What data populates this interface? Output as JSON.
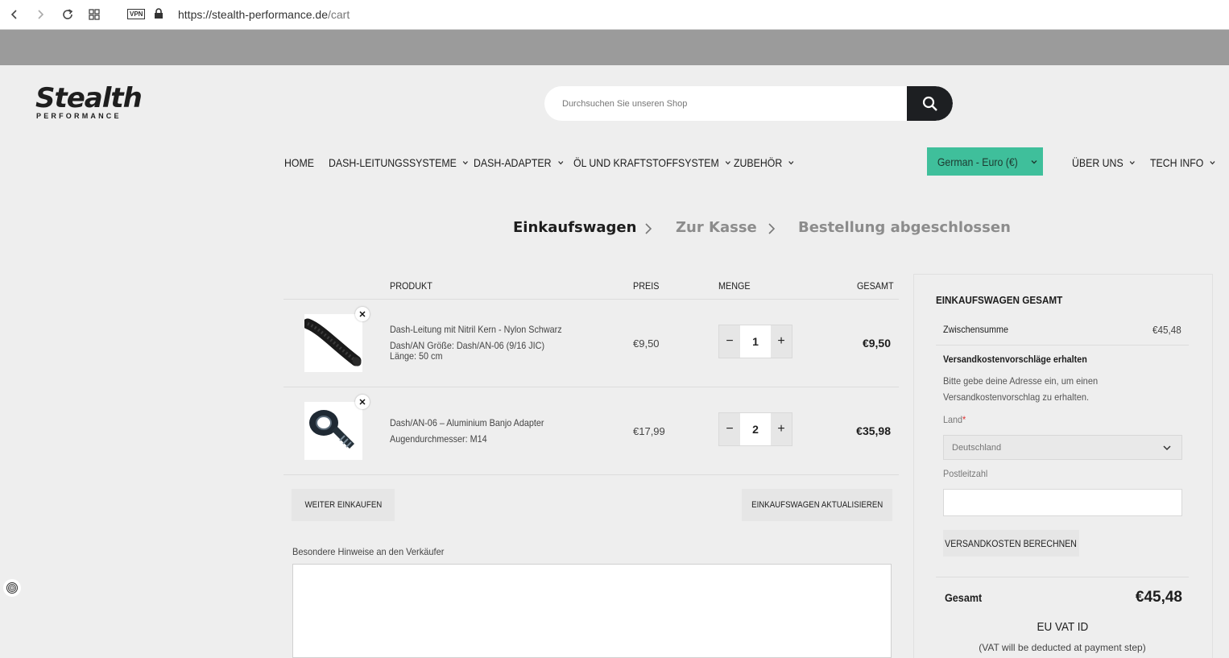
{
  "browser": {
    "vpn_label": "VPN",
    "url_host": "https://stealth-performance.de",
    "url_path": "/cart"
  },
  "header": {
    "logo_main": "Stealth",
    "logo_sub": "PERFORMANCE",
    "search_placeholder": "Durchsuchen Sie unseren Shop"
  },
  "nav": {
    "home": "HOME",
    "dash_leitung": "DASH-LEITUNGSSYSTEME",
    "dash_adapter": "DASH-ADAPTER",
    "oel": "ÖL UND KRAFTSTOFFSYSTEM",
    "zubehoer": "ZUBEHÖR",
    "currency": "German - Euro (€)",
    "ueber_uns": "ÜBER UNS",
    "tech_info": "TECH INFO"
  },
  "steps": {
    "cart": "Einkaufswagen",
    "checkout": "Zur Kasse",
    "done": "Bestellung abgeschlossen"
  },
  "table": {
    "col_product": "PRODUKT",
    "col_price": "PREIS",
    "col_qty": "MENGE",
    "col_total": "GESAMT",
    "items": [
      {
        "name": "Dash-Leitung mit Nitril Kern - Nylon Schwarz",
        "meta1": "Dash/AN Größe: Dash/AN-06 (9/16 JIC)",
        "meta2": "Länge: 50 cm",
        "price": "€9,50",
        "qty": "1",
        "total": "€9,50"
      },
      {
        "name": "Dash/AN-06 – Aluminium Banjo Adapter",
        "meta1": "Augendurchmesser: M14",
        "meta2": "",
        "price": "€17,99",
        "qty": "2",
        "total": "€35,98"
      }
    ],
    "continue_label": "WEITER EINKAUFEN",
    "update_label": "EINKAUFSWAGEN AKTUALISIEREN",
    "notes_label": "Besondere Hinweise an den Verkäufer"
  },
  "summary": {
    "title": "EINKAUFSWAGEN GESAMT",
    "subtotal_label": "Zwischensumme",
    "subtotal_value": "€45,48",
    "shipping_title": "Versandkostenvorschläge erhalten",
    "shipping_text": "Bitte gebe deine Adresse ein, um einen Versandkostenvorschlag zu erhalten.",
    "country_label": "Land",
    "country_required": "*",
    "country_value": "Deutschland",
    "zip_label": "Postleitzahl",
    "calc_label": "VERSANDKOSTEN BERECHNEN",
    "total_label": "Gesamt",
    "total_value": "€45,48",
    "vat_title": "EU VAT ID",
    "vat_note": "(VAT will be deducted at payment step)"
  },
  "colors": {
    "accent": "#3fbf9b",
    "dark": "#1d1f22"
  }
}
